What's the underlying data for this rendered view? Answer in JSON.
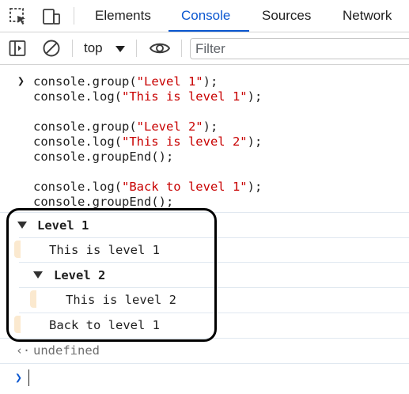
{
  "tabs": [
    {
      "label": "Elements",
      "active": false
    },
    {
      "label": "Console",
      "active": true
    },
    {
      "label": "Sources",
      "active": false
    },
    {
      "label": "Network",
      "active": false
    }
  ],
  "toolbar": {
    "context": "top",
    "filter_placeholder": "Filter",
    "filter_value": ""
  },
  "code_lines": [
    {
      "plain1": "console.group(",
      "str": "\"Level 1\"",
      "plain2": ");"
    },
    {
      "plain1": "console.log(",
      "str": "\"This is level 1\"",
      "plain2": ");"
    },
    {
      "plain1": "console.group(",
      "str": "\"Level 2\"",
      "plain2": ");"
    },
    {
      "plain1": "console.log(",
      "str": "\"This is level 2\"",
      "plain2": ");"
    },
    {
      "plain1": "console.groupEnd();",
      "str": "",
      "plain2": ""
    },
    {
      "plain1": "console.log(",
      "str": "\"Back to level 1\"",
      "plain2": ");"
    },
    {
      "plain1": "console.groupEnd();",
      "str": "",
      "plain2": ""
    }
  ],
  "output": {
    "group1_label": "Level 1",
    "group1_log": "This is level 1",
    "group2_label": "Level 2",
    "group2_log": "This is level 2",
    "back_log": "Back to level 1",
    "return_value": "undefined"
  },
  "colors": {
    "accent": "#0b57d0",
    "string": "#c80000",
    "group_indent": "#fbe9cf"
  },
  "icons": [
    "inspect-element-icon",
    "device-toolbar-icon",
    "sidebar-toggle-icon",
    "clear-console-icon",
    "dropdown-arrow-icon",
    "eye-icon",
    "collapse-triangle-icon",
    "prompt-chevron-icon",
    "return-arrow-icon"
  ]
}
